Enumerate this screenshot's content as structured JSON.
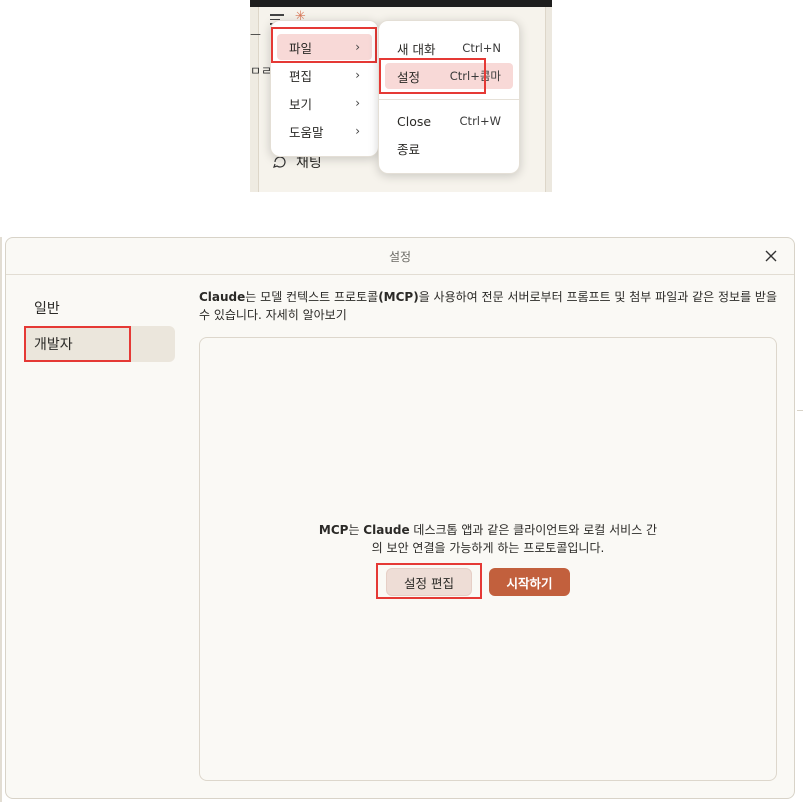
{
  "app_sidebar": {
    "chat_label": "채팅",
    "fragment_top": "ㅡ",
    "fragment_mid": "ㅁㄹ"
  },
  "menu_main": {
    "items": [
      {
        "label": "파일"
      },
      {
        "label": "편집"
      },
      {
        "label": "보기"
      },
      {
        "label": "도움말"
      }
    ]
  },
  "menu_file": {
    "items": [
      {
        "label": "새 대화",
        "shortcut": "Ctrl+N"
      },
      {
        "label": "설정",
        "shortcut": "Ctrl+콤마"
      },
      {
        "label": "Close",
        "shortcut": "Ctrl+W"
      },
      {
        "label": "종료",
        "shortcut": ""
      }
    ]
  },
  "dialog": {
    "title": "설정",
    "nav": [
      {
        "label": "일반"
      },
      {
        "label": "개발자"
      }
    ],
    "desc_brand": "Claude",
    "desc_part1": "는 모델 컨텍스트 프로토콜",
    "desc_mcp": "(MCP)",
    "desc_part2": "을 사용하여 전문 서버로부터 프롬프트 및 첨부 파일과 같은 정보를 받을 수 있습니다. 자세히 알아보기",
    "panel_mcp": "MCP",
    "panel_part1": "는 ",
    "panel_brand": "Claude",
    "panel_part2": " 데스크톱 앱과 같은 클라이언트와 로컬 서비스 간",
    "panel_line2": "의 보안 연결을 가능하게 하는 프로토콜입니다.",
    "edit_button": "설정 편집",
    "start_button": "시작하기"
  },
  "colors": {
    "accent": "#c2603d",
    "highlight": "#e53935",
    "menu_active": "#f8d9d7",
    "nav_selected": "#ebe6dc"
  }
}
